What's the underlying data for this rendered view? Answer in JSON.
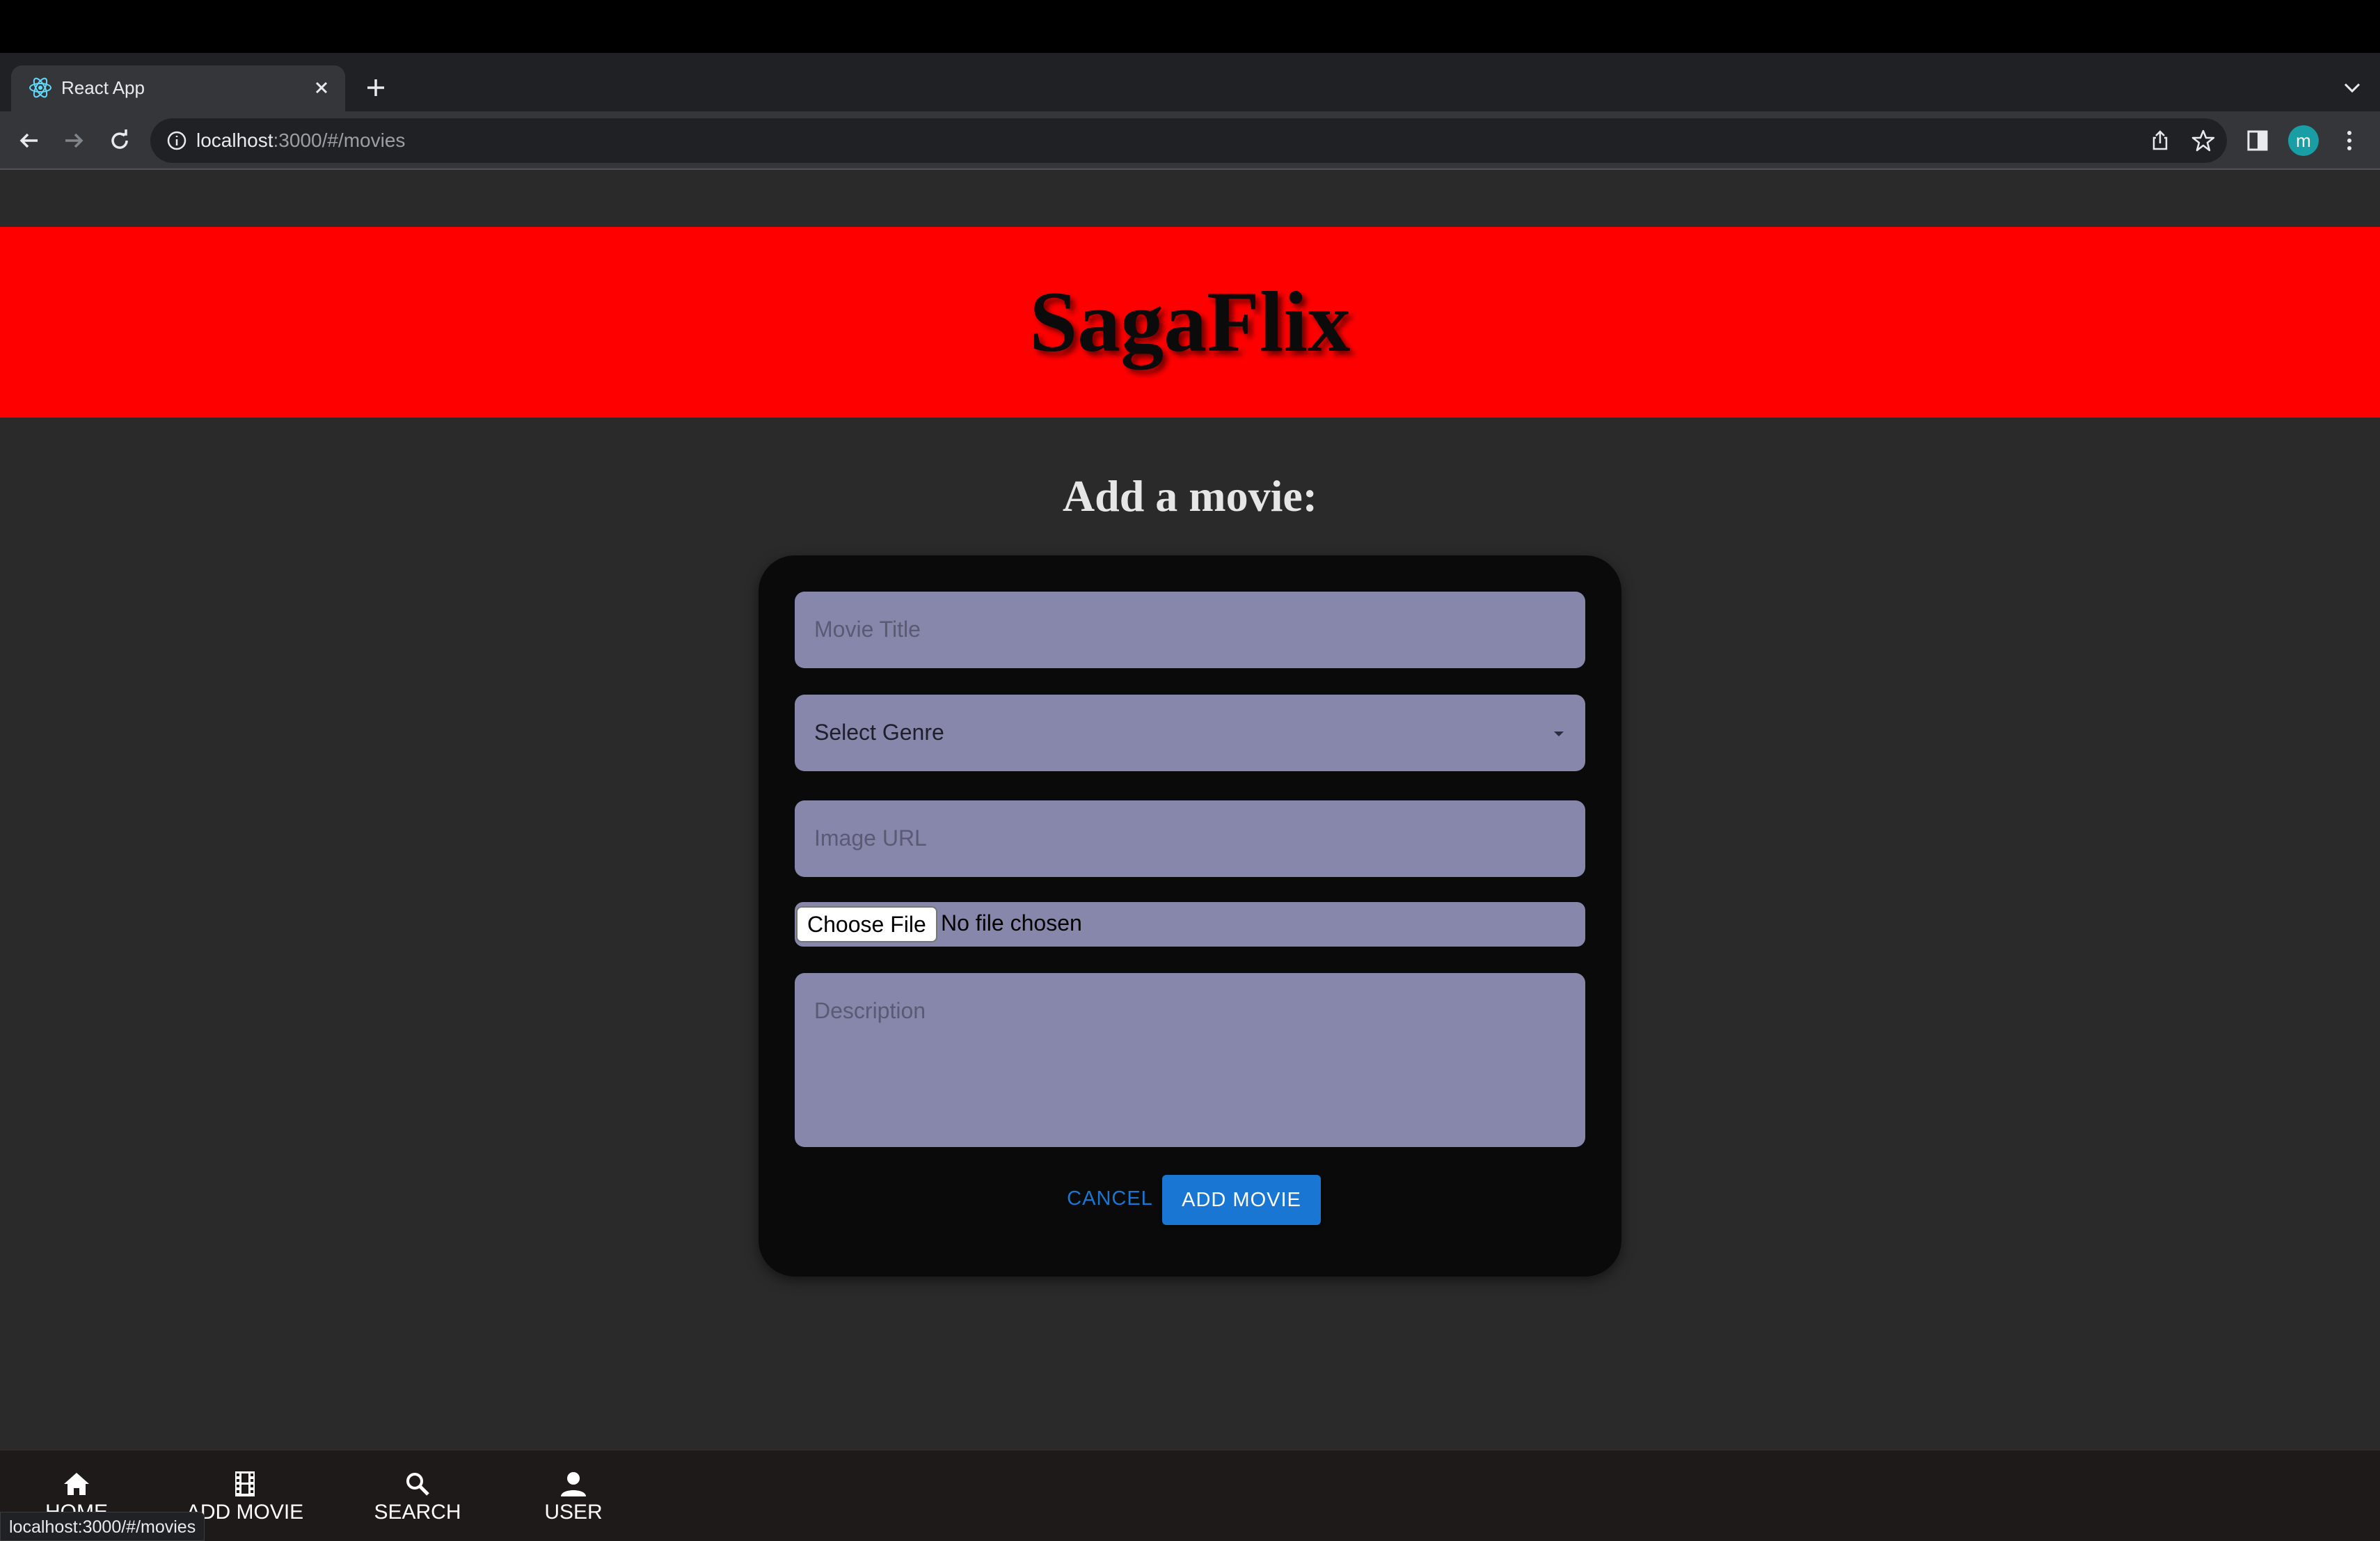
{
  "browser": {
    "tab_title": "React App",
    "url_host": "localhost",
    "url_rest": ":3000/#/movies",
    "profile_initial": "m",
    "status_url": "localhost:3000/#/movies"
  },
  "header": {
    "brand": "SagaFlix"
  },
  "form": {
    "heading": "Add a movie:",
    "title_placeholder": "Movie Title",
    "genre_label": "Select Genre",
    "image_placeholder": "Image URL",
    "file_button": "Choose File",
    "file_status": "No file chosen",
    "description_placeholder": "Description",
    "cancel_label": "CANCEL",
    "submit_label": "ADD MOVIE"
  },
  "bottom_nav": {
    "items": [
      {
        "label": "HOME",
        "icon": "home-icon"
      },
      {
        "label": "ADD MOVIE",
        "icon": "movie-icon"
      },
      {
        "label": "SEARCH",
        "icon": "search-icon"
      },
      {
        "label": "USER",
        "icon": "person-icon"
      }
    ]
  },
  "colors": {
    "banner": "#ff0000",
    "card": "#0a0a0a",
    "field": "#8787ab",
    "primary": "#1976d2",
    "page_bg": "#2a2a2a"
  }
}
